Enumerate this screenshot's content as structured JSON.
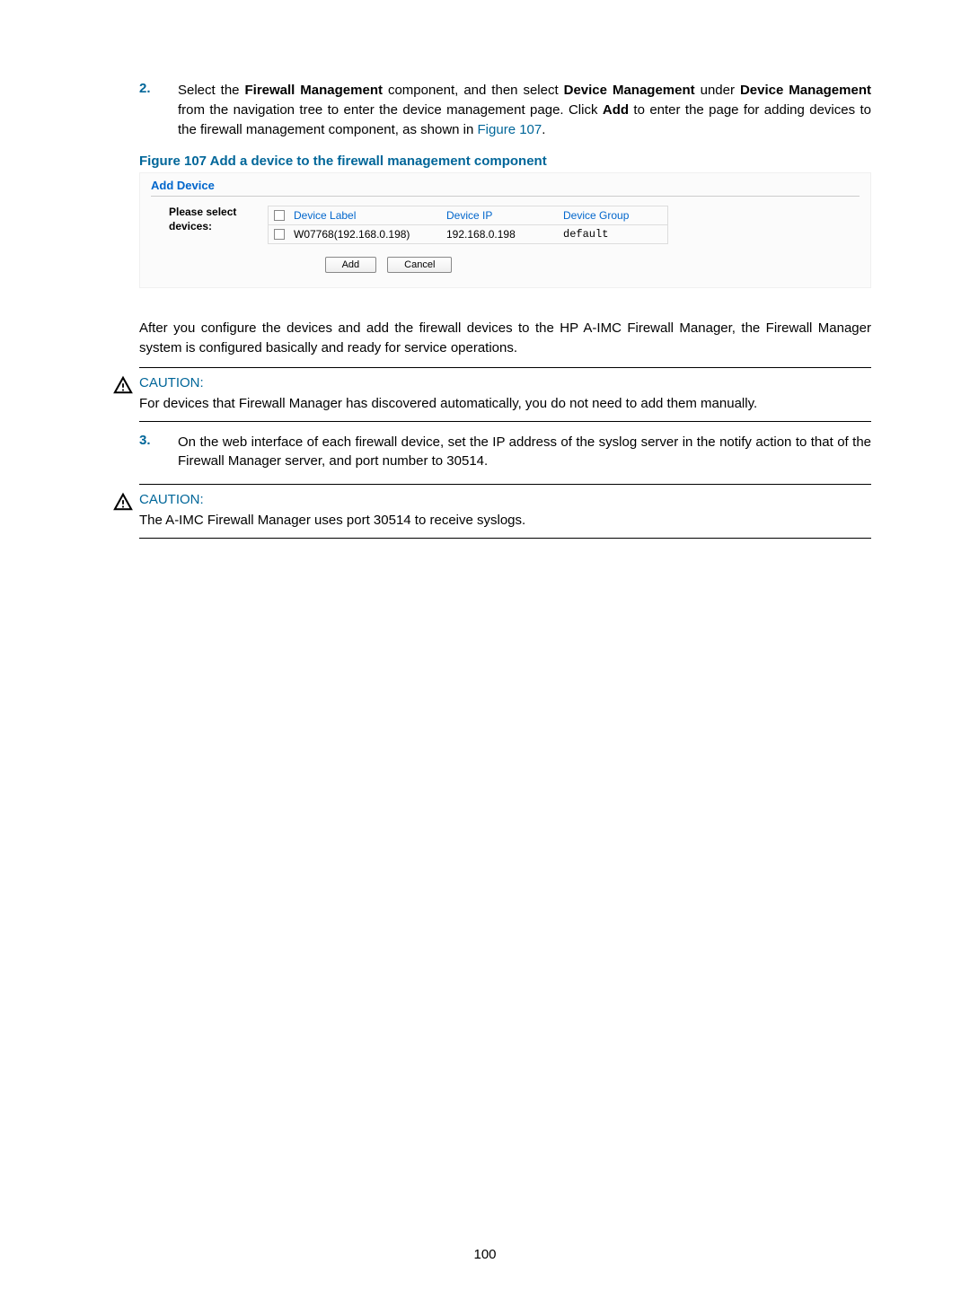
{
  "step2": {
    "num": "2.",
    "text_plain": "Select the ",
    "b1": "Firewall Management",
    "t2": " component, and then select ",
    "b2": "Device Management",
    "t3": " under ",
    "b3": "Device Management",
    "t4": " from the navigation tree to enter the device management page. Click ",
    "b4": "Add",
    "t5": " to enter the page for adding devices to the firewall management component, as shown in ",
    "link": "Figure 107",
    "t6": "."
  },
  "figcap": "Figure 107 Add a device to the firewall management component",
  "scr": {
    "title": "Add Device",
    "label1": "Please select",
    "label2": "devices:",
    "headers": {
      "label": "Device Label",
      "ip": "Device IP",
      "group": "Device Group"
    },
    "row": {
      "label": "W07768(192.168.0.198)",
      "ip": "192.168.0.198",
      "group": "default"
    },
    "btn_add": "Add",
    "btn_cancel": "Cancel"
  },
  "para_after": "After you configure the devices and add the firewall devices to the HP A-IMC Firewall Manager, the Firewall Manager system is configured basically and ready for service operations.",
  "caution1": {
    "head": "CAUTION:",
    "body": "For devices that Firewall Manager has discovered automatically, you do not need to add them manually."
  },
  "step3": {
    "num": "3.",
    "body": "On the web interface of each firewall device, set the IP address of the syslog server in the notify action to that of the Firewall Manager server, and port number to 30514."
  },
  "caution2": {
    "head": "CAUTION:",
    "body": "The A-IMC Firewall Manager uses port 30514 to receive syslogs."
  },
  "pagenum": "100"
}
